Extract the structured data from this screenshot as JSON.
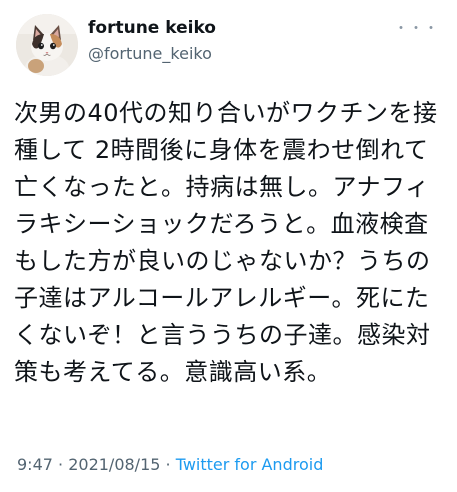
{
  "user": {
    "display_name": "fortune keiko",
    "handle": "@fortune_keiko",
    "avatar_icon": "kitten-avatar"
  },
  "menu": {
    "more_label": "・・・"
  },
  "tweet": {
    "text": "次男の40代の知り合いがワクチンを接種して 2時間後に身体を震わせ倒れて亡くなったと。持病は無し。アナフィラキシーショックだろうと。血液検査もした方が良いのじゃないか？うちの子達はアルコールアレルギー。死にたくないぞ！と言ううちの子達。感染対策も考えてる。意識高い系。"
  },
  "meta": {
    "time": "9:47",
    "separator1": " · ",
    "date": "2021/08/15",
    "separator2": " · ",
    "source": "Twitter for Android"
  },
  "colors": {
    "text": "#0f1419",
    "secondary": "#536471",
    "link": "#1d9bf0"
  }
}
